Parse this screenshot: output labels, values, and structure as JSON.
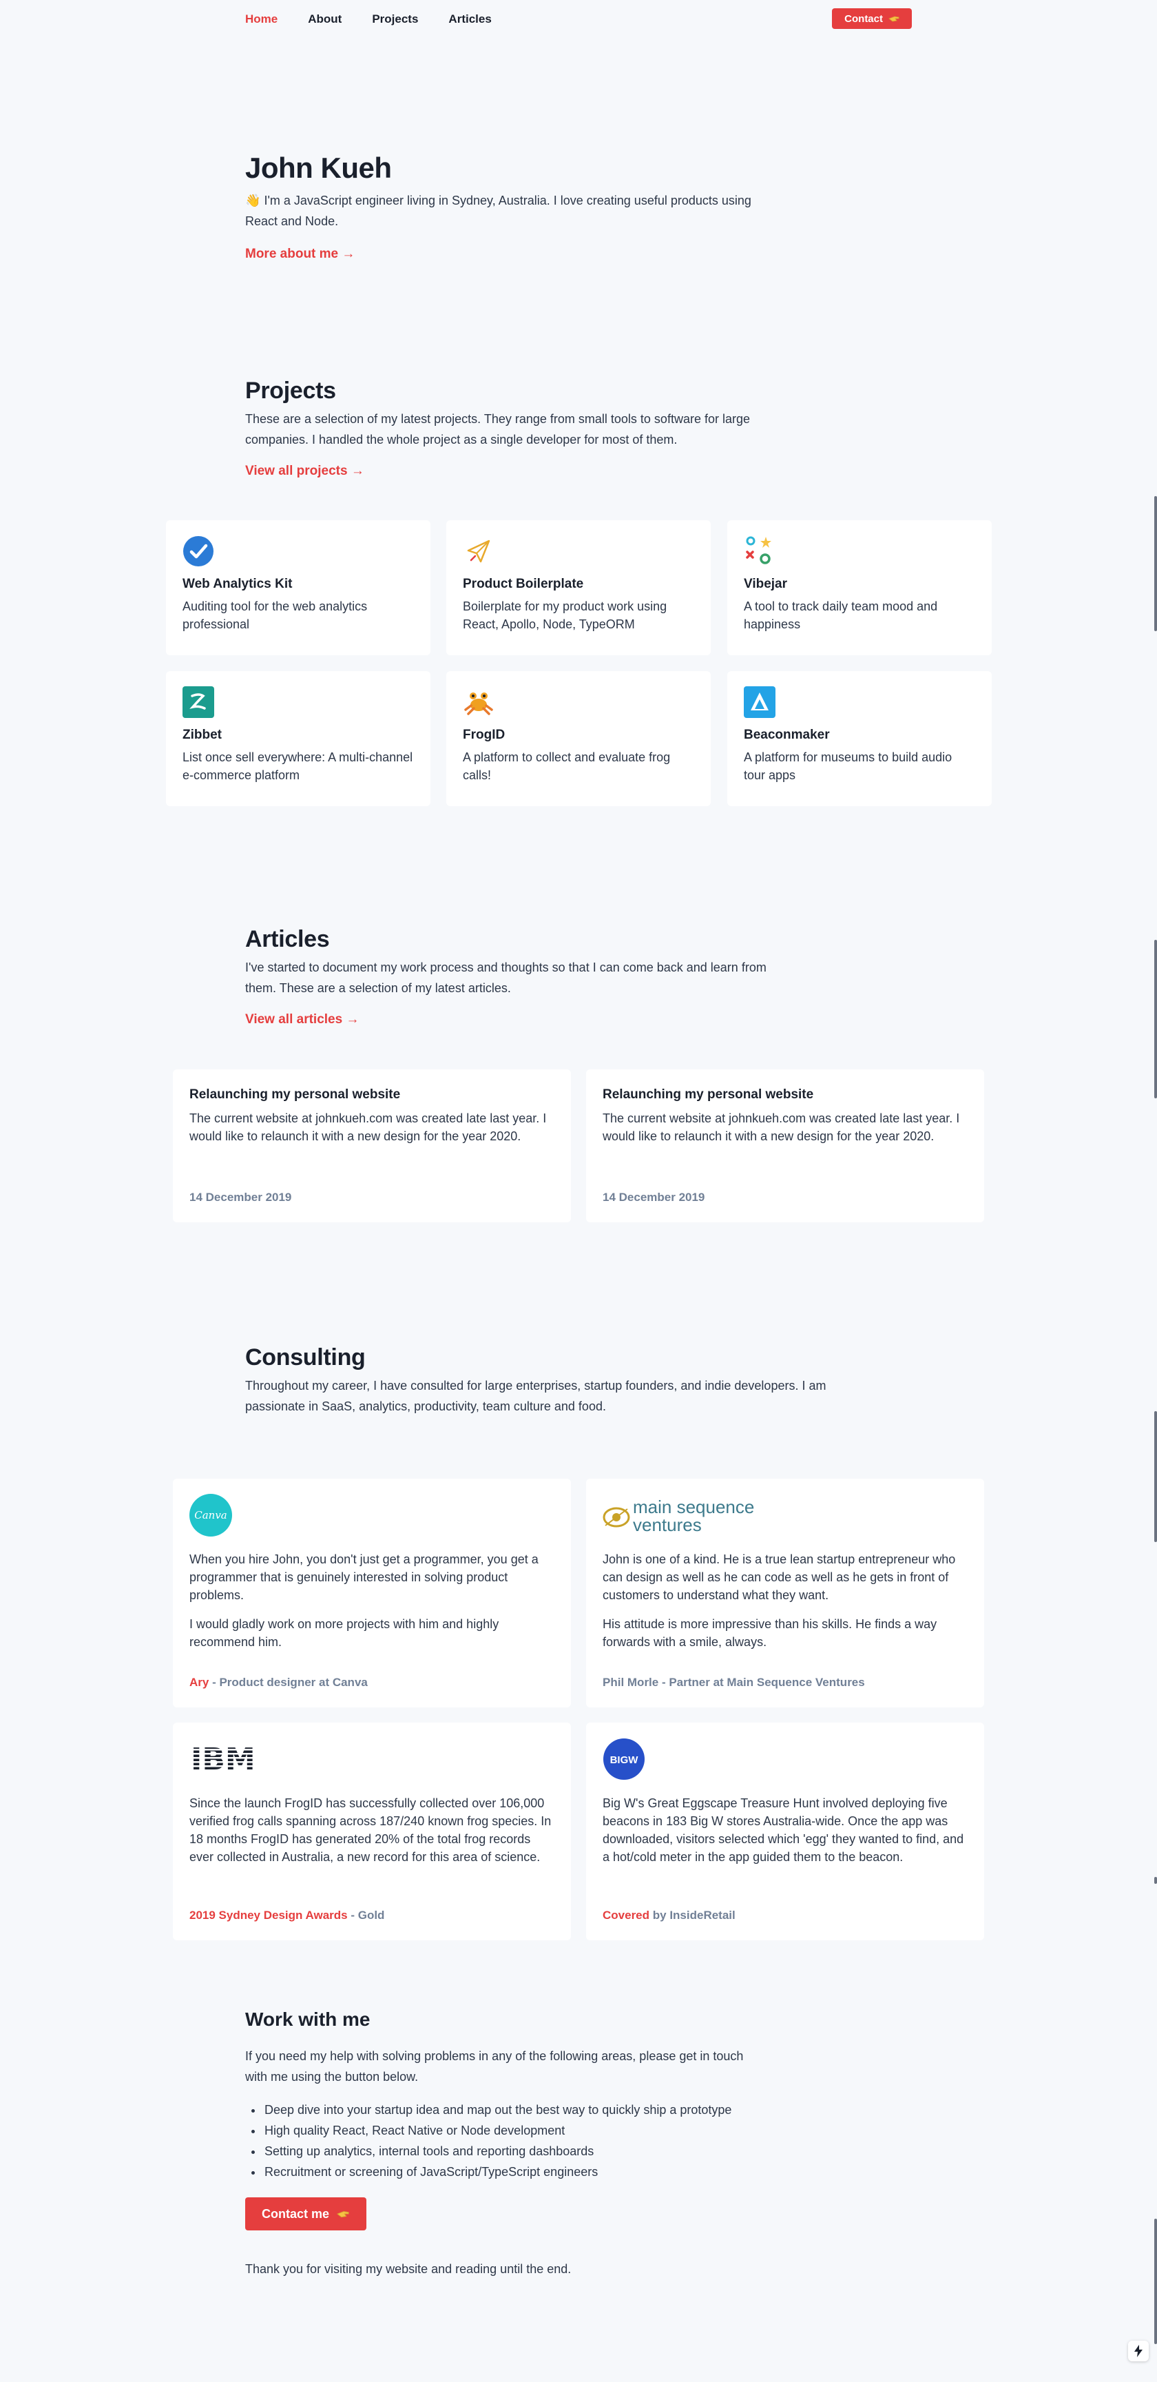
{
  "nav": {
    "links": [
      {
        "label": "Home",
        "active": true
      },
      {
        "label": "About",
        "active": false
      },
      {
        "label": "Projects",
        "active": false
      },
      {
        "label": "Articles",
        "active": false
      }
    ],
    "contact_label": "Contact",
    "contact_icon": "pointing-hand-icon"
  },
  "hero": {
    "name": "John Kueh",
    "wave_emoji": "👋",
    "intro": "I'm a JavaScript engineer living in Sydney, Australia. I love creating useful products using React and Node.",
    "more_link": "More about me →"
  },
  "projects": {
    "heading": "Projects",
    "description": "These are a selection of my latest projects. They range from small tools to software for large companies. I handled the whole project as a single developer for most of them.",
    "view_all": "View all projects →",
    "items": [
      {
        "title": "Web Analytics Kit",
        "description": "Auditing tool for the web analytics professional",
        "icon": "checkmark-circle-icon"
      },
      {
        "title": "Product Boilerplate",
        "description": "Boilerplate for my product work using React, Apollo, Node, TypeORM",
        "icon": "paper-plane-icon"
      },
      {
        "title": "Vibejar",
        "description": "A tool to track daily team mood and happiness",
        "icon": "vibejar-shapes-icon"
      },
      {
        "title": "Zibbet",
        "description": "List once sell everywhere: A multi-channel e-commerce platform",
        "icon": "zibbet-logo-icon"
      },
      {
        "title": "FrogID",
        "description": "A platform to collect and evaluate frog calls!",
        "icon": "frog-icon"
      },
      {
        "title": "Beaconmaker",
        "description": "A platform for museums to build audio tour apps",
        "icon": "beaconmaker-logo-icon"
      }
    ]
  },
  "articles": {
    "heading": "Articles",
    "description": "I've started to document my work process and thoughts so that I can come back and learn from them. These are a selection of my latest articles.",
    "view_all": "View all articles →",
    "items": [
      {
        "title": "Relaunching my personal website",
        "excerpt": "The current website at johnkueh.com was created late last year. I would like to relaunch it with a new design for the year 2020.",
        "date": "14 December 2019"
      },
      {
        "title": "Relaunching my personal website",
        "excerpt": "The current website at johnkueh.com was created late last year. I would like to relaunch it with a new design for the year 2020.",
        "date": "14 December 2019"
      }
    ]
  },
  "consulting": {
    "heading": "Consulting",
    "description": "Throughout my career, I have consulted for large enterprises, startup founders, and indie developers. I am passionate in SaaS, analytics, productivity, team culture and food.",
    "testimonials": [
      {
        "logo": "canva-logo-icon",
        "logo_text": "Canva",
        "paragraphs": [
          "When you hire John, you don't just get a programmer, you get a programmer that is genuinely interested in solving product problems.",
          "I would gladly work on more projects with him and highly recommend him."
        ],
        "footer_accent": "Ary",
        "footer_rest": " - Product designer at Canva"
      },
      {
        "logo": "main-sequence-ventures-logo-icon",
        "logo_text_1": "main sequence",
        "logo_text_2": "ventures",
        "paragraphs": [
          "John is one of a kind. He is a true lean startup entrepreneur who can design as well as he can code as well as he gets in front of customers to understand what they want.",
          "His attitude is more impressive than his skills. He finds a way forwards with a smile, always."
        ],
        "footer_accent": "",
        "footer_rest": "Phil Morle - Partner at Main Sequence Ventures"
      },
      {
        "logo": "ibm-logo-icon",
        "logo_text": "IBM",
        "paragraphs": [
          "Since the launch FrogID has successfully collected over 106,000 verified frog calls spanning across 187/240 known frog species. In 18 months FrogID has generated 20% of the total frog records ever collected in Australia, a new record for this area of science."
        ],
        "footer_accent": "2019 Sydney Design Awards",
        "footer_rest": " - Gold"
      },
      {
        "logo": "bigw-logo-icon",
        "logo_text": "BIGW",
        "paragraphs": [
          "Big W's Great Eggscape Treasure Hunt involved deploying five beacons in 183 Big W stores Australia-wide. Once the app was downloaded, visitors selected which 'egg' they wanted to find, and a hot/cold meter in the app guided them to the beacon."
        ],
        "footer_accent": "Covered",
        "footer_rest": " by InsideRetail"
      }
    ]
  },
  "work": {
    "heading": "Work with me",
    "intro": "If you need my help with solving problems in any of the following areas, please get in touch with me using the button below.",
    "areas": [
      "Deep dive into your startup idea and map out the best way to quickly ship a prototype",
      "High quality React, React Native or Node development",
      "Setting up analytics, internal tools and reporting dashboards",
      "Recruitment or screening of JavaScript/TypeScript engineers"
    ],
    "button_label": "Contact me",
    "thanks": "Thank you for visiting my website and reading until the end."
  },
  "widget": {
    "icon": "lightning-bolt-icon"
  },
  "colors": {
    "accent": "#e53e3e",
    "background": "#f6f8fb",
    "text": "#1a202c",
    "muted": "#718096"
  }
}
